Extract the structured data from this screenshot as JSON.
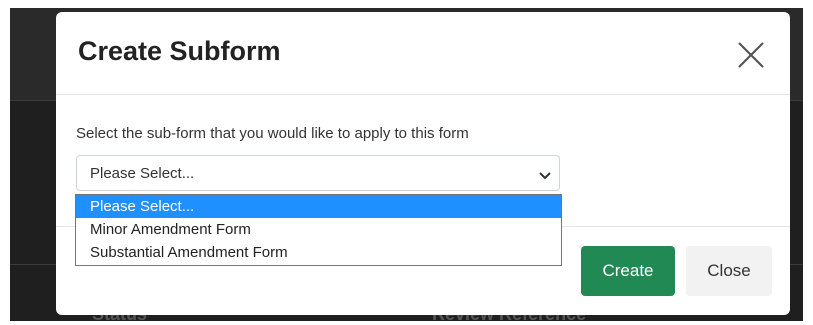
{
  "background": {
    "col_status": "Status",
    "col_review_reference": "Review Reference"
  },
  "modal": {
    "title": "Create Subform",
    "prompt": "Select the sub-form that you would like to apply to this form",
    "select": {
      "value": "Please Select..."
    },
    "dropdown_options": [
      "Please Select...",
      "Minor Amendment Form",
      "Substantial Amendment Form"
    ],
    "selected_index": 0,
    "buttons": {
      "create": "Create",
      "close": "Close"
    }
  },
  "colors": {
    "create_button": "#218a54",
    "highlight": "#1e90ff",
    "backdrop": "#1f1f1f"
  },
  "icons": {
    "close": "close-icon",
    "dropdown": "chevron-down-icon"
  }
}
